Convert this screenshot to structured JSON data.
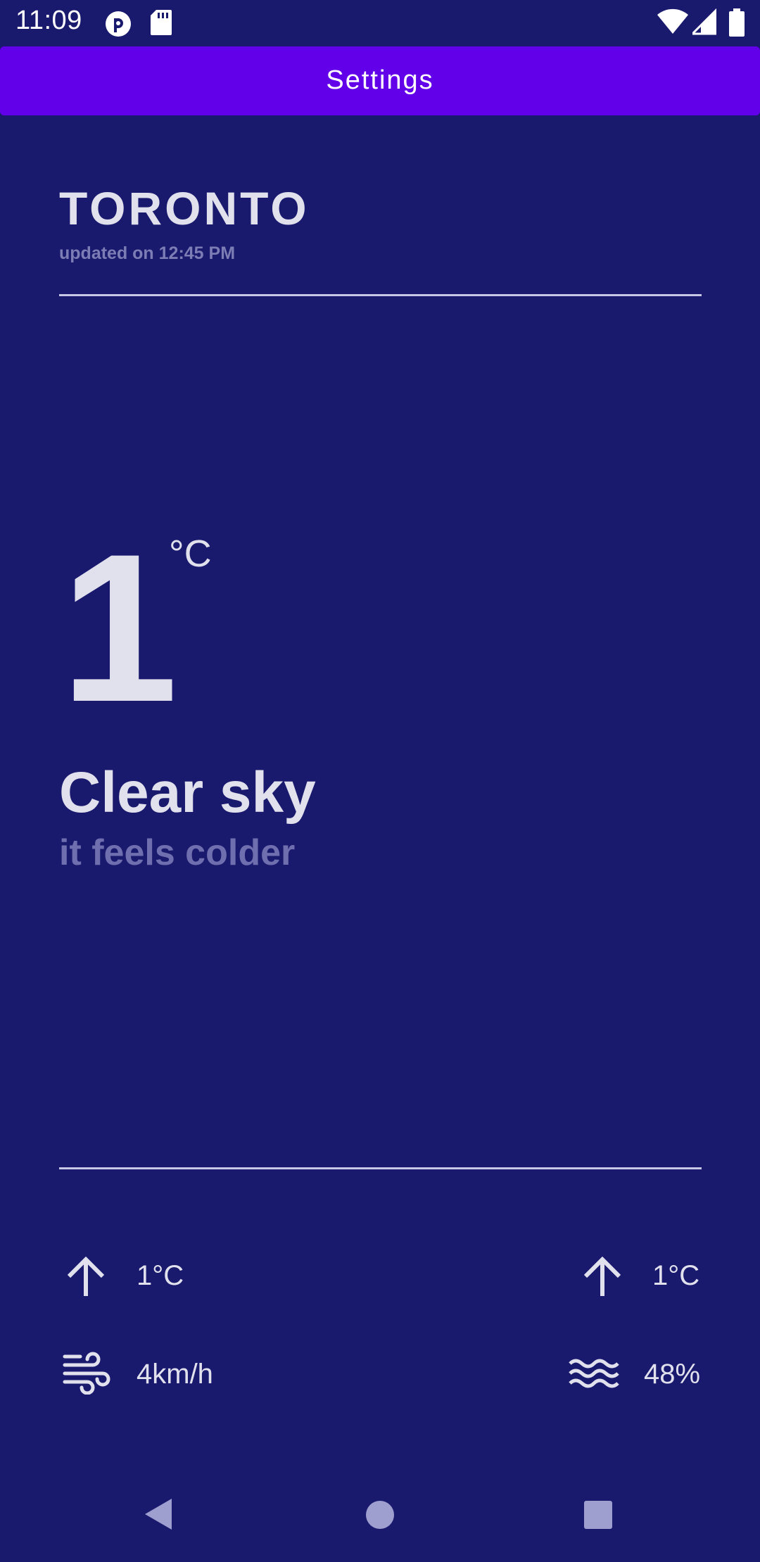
{
  "status_bar": {
    "time": "11:09",
    "icons": [
      "notification-app-icon",
      "sd-card-icon",
      "wifi-icon",
      "signal-icon",
      "battery-icon"
    ]
  },
  "app_bar": {
    "title": "Settings",
    "color": "#6200ea"
  },
  "weather": {
    "city": "TORONTO",
    "updated": "updated on 12:45 PM",
    "temperature": "1",
    "unit": "°C",
    "condition": "Clear sky",
    "feels": "it feels colder"
  },
  "stats": {
    "temp_min": "1°C",
    "temp_max": "1°C",
    "wind": "4km/h",
    "humidity": "48%"
  },
  "nav_bar": {
    "buttons": [
      "back-button",
      "home-button",
      "recents-button"
    ]
  },
  "colors": {
    "background": "#19196e",
    "text": "#e1e1ee",
    "muted": "#7d7db5"
  }
}
